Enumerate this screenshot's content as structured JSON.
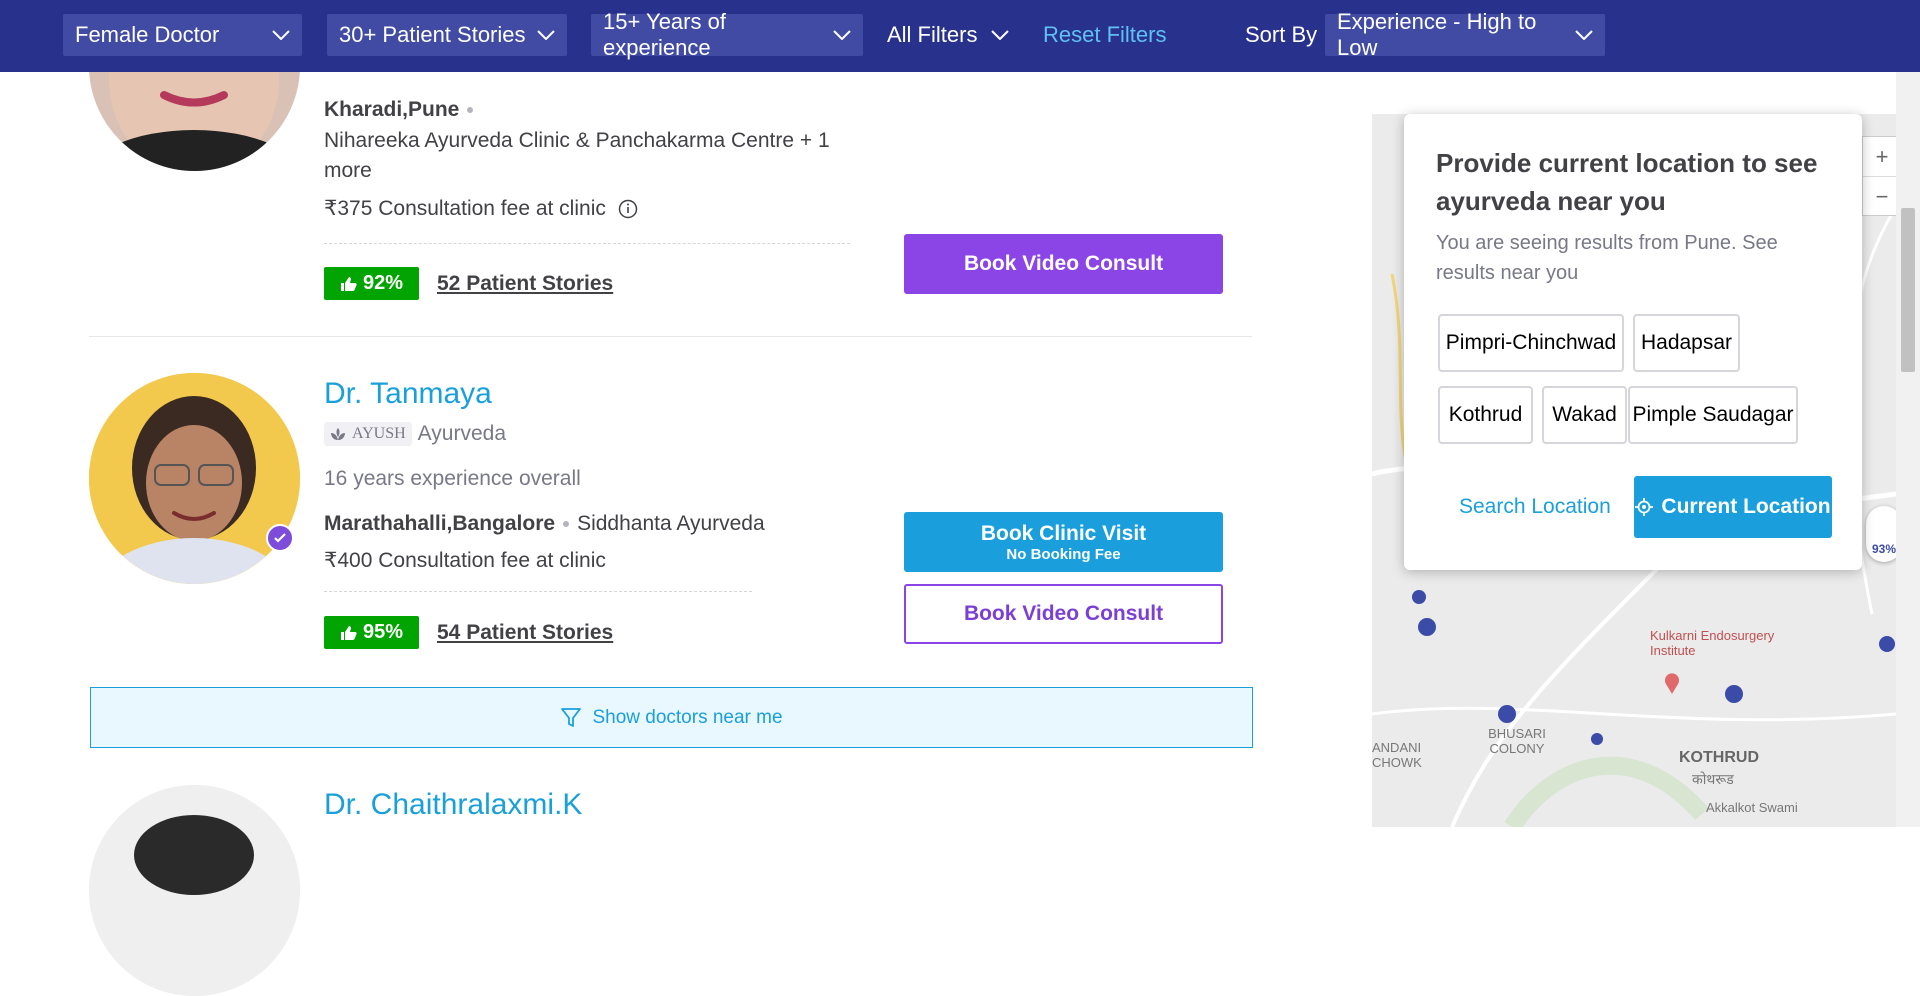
{
  "filters": {
    "gender": "Female Doctor",
    "stories": "30+ Patient Stories",
    "experience": "15+ Years of experience",
    "all_filters": "All Filters",
    "reset": "Reset Filters",
    "sort_label": "Sort By",
    "sort_value": "Experience - High to Low"
  },
  "doctors": [
    {
      "location": "Kharadi,Pune",
      "clinic": "Nihareeka Ayurveda Clinic & Panchakarma Centre + 1 more",
      "fee": "₹375 Consultation fee at clinic",
      "recommend": "92%",
      "stories": "52 Patient Stories",
      "video_btn": "Book Video Consult"
    },
    {
      "name": "Dr. Tanmaya",
      "badge": "AYUSH",
      "specialty": "Ayurveda",
      "experience": "16 years experience overall",
      "location": "Marathahalli,Bangalore",
      "clinic": "Siddhanta Ayurveda",
      "fee": "₹400 Consultation fee at clinic",
      "recommend": "95%",
      "stories": "54 Patient Stories",
      "clinic_btn": "Book Clinic Visit",
      "clinic_btn_sub": "No Booking Fee",
      "video_btn": "Book Video Consult"
    },
    {
      "name": "Dr. Chaithralaxmi.K"
    }
  ],
  "show_near": "Show doctors near me",
  "popup": {
    "title": "Provide current location to see ayurveda near you",
    "subtitle": "You are seeing results from Pune. See results near you",
    "chips": [
      "Pimpri-Chinchwad",
      "Hadapsar",
      "Kothrud",
      "Wakad",
      "Pimple Saudagar"
    ],
    "search_location": "Search Location",
    "current_location": "Current Location"
  },
  "map": {
    "labels": {
      "kulkarni": "Kulkarni Endosurgery Institute",
      "bhusari": "BHUSARI COLONY",
      "kothrud": "KOTHRUD",
      "kothrud_mr": "कोथरूड",
      "andani": "ANDANI CHOWK",
      "akkalkot": "Akkalkot Swami",
      "badge": "93%"
    },
    "zoom_in": "+",
    "zoom_out": "−"
  },
  "colors": {
    "topbar": "#28328c",
    "accent_blue": "#199fd9",
    "purple": "#8b45e6",
    "green": "#01a400"
  }
}
